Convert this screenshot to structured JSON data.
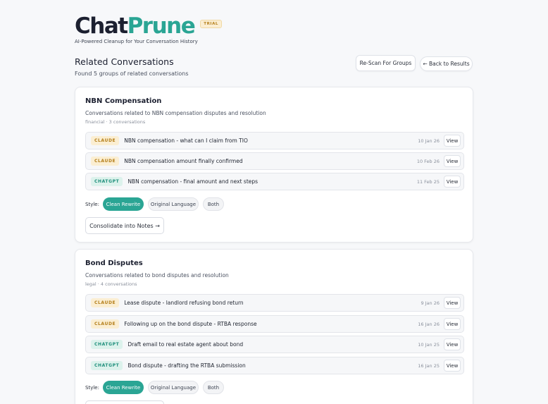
{
  "brand": {
    "logo_part1": "Chat",
    "logo_part2": "Prune",
    "badge": "TRIAL",
    "tagline": "AI-Powered Cleanup for Your Conversation History"
  },
  "header": {
    "title": "Related Conversations",
    "subtitle": "Found 5 groups of related conversations",
    "rescan_label": "Re-Scan For Groups",
    "back_label": "← Back to Results"
  },
  "groups": [
    {
      "title": "NBN Compensation",
      "description": "Conversations related to NBN compensation disputes and resolution",
      "meta": "financial · 3 conversations",
      "conversations": [
        {
          "source": "CLAUDE",
          "title": "NBN compensation - what can I claim from TIO",
          "date": "10 Jan 26",
          "view": "View"
        },
        {
          "source": "CLAUDE",
          "title": "NBN compensation amount finally confirmed",
          "date": "10 Feb 26",
          "view": "View"
        },
        {
          "source": "CHATGPT",
          "title": "NBN compensation - final amount and next steps",
          "date": "11 Feb 25",
          "view": "View"
        }
      ],
      "style_label": "Style:",
      "style_options": [
        "Clean Rewrite",
        "Original Language",
        "Both"
      ],
      "style_selected": "Clean Rewrite",
      "consolidate_label": "Consolidate into Notes →"
    },
    {
      "title": "Bond Disputes",
      "description": "Conversations related to bond disputes and resolution",
      "meta": "legal · 4 conversations",
      "conversations": [
        {
          "source": "CLAUDE",
          "title": "Lease dispute - landlord refusing bond return",
          "date": "9 Jan 26",
          "view": "View"
        },
        {
          "source": "CLAUDE",
          "title": "Following up on the bond dispute - RTBA response",
          "date": "16 Jan 26",
          "view": "View"
        },
        {
          "source": "CHATGPT",
          "title": "Draft email to real estate agent about bond",
          "date": "10 Jan 25",
          "view": "View"
        },
        {
          "source": "CHATGPT",
          "title": "Bond dispute - drafting the RTBA submission",
          "date": "16 Jan 25",
          "view": "View"
        }
      ],
      "style_label": "Style:",
      "style_options": [
        "Clean Rewrite",
        "Original Language",
        "Both"
      ],
      "style_selected": "Clean Rewrite"
    }
  ],
  "colors": {
    "accent": "#2aa594",
    "claude_badge": "#b47f1a",
    "chatgpt_badge": "#1f8f7c"
  }
}
